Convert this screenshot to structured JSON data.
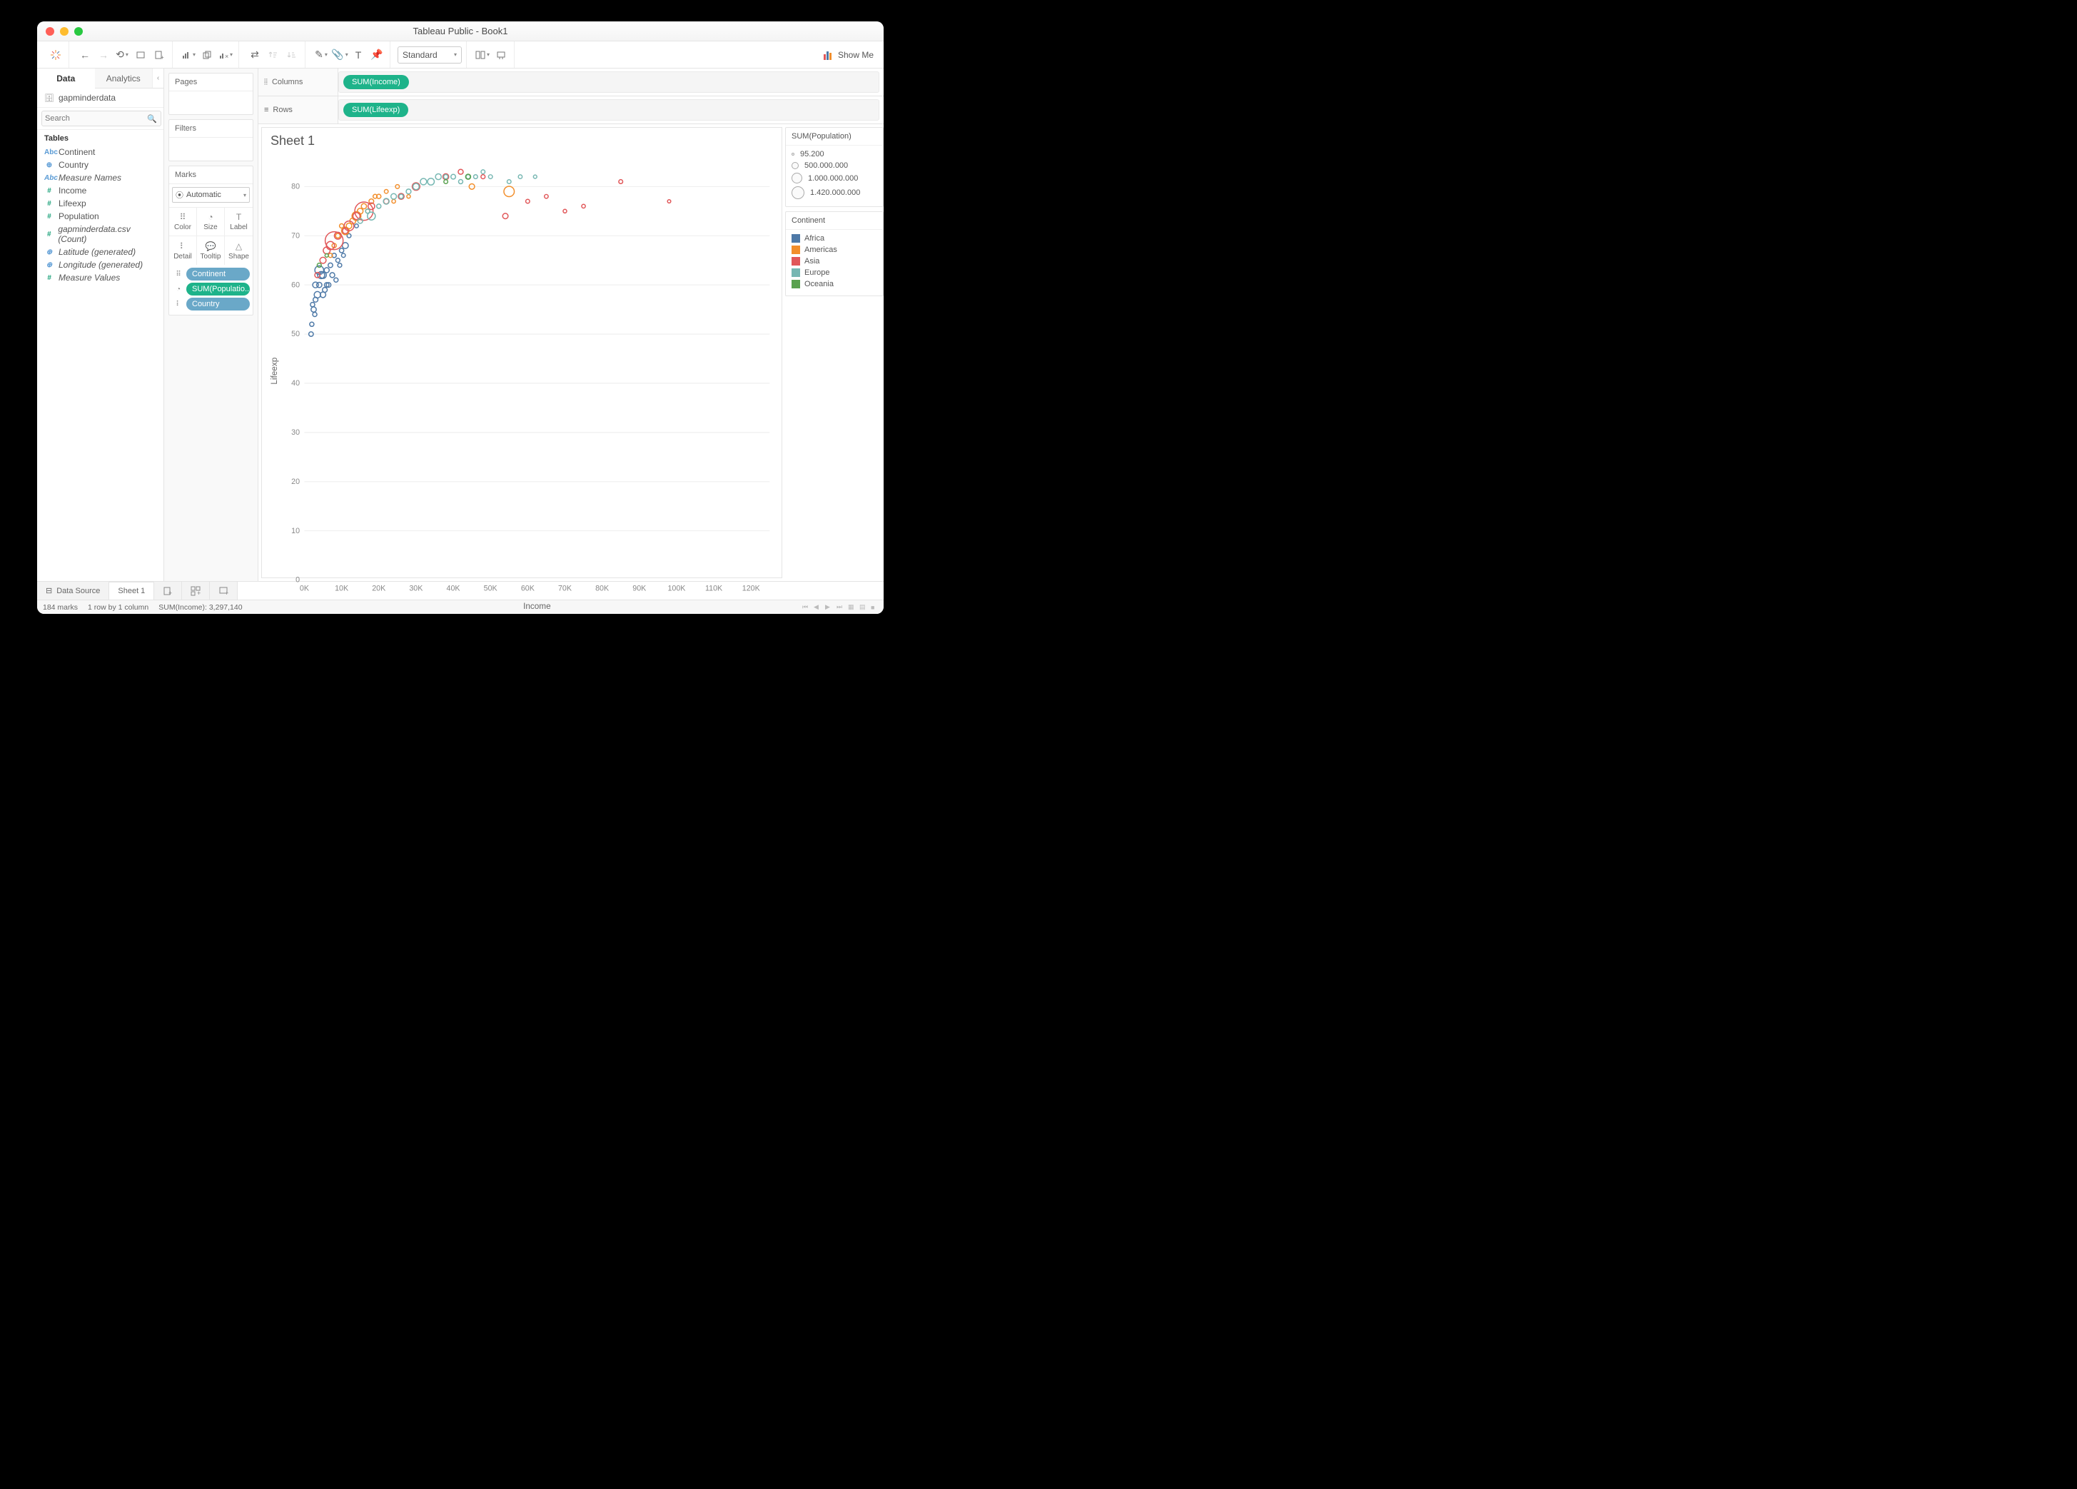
{
  "window": {
    "title": "Tableau Public - Book1"
  },
  "toolbar": {
    "fit_mode": "Standard",
    "show_me": "Show Me"
  },
  "sidebar": {
    "tabs": {
      "data": "Data",
      "analytics": "Analytics"
    },
    "datasource": "gapminderdata",
    "search_placeholder": "Search",
    "tables_title": "Tables",
    "fields": [
      {
        "name": "Continent",
        "type": "dim",
        "icon": "Abc"
      },
      {
        "name": "Country",
        "type": "geo",
        "icon": "⊕"
      },
      {
        "name": "Measure Names",
        "type": "dim",
        "icon": "Abc",
        "italic": true
      },
      {
        "name": "Income",
        "type": "meas",
        "icon": "#"
      },
      {
        "name": "Lifeexp",
        "type": "meas",
        "icon": "#"
      },
      {
        "name": "Population",
        "type": "meas",
        "icon": "#"
      },
      {
        "name": "gapminderdata.csv (Count)",
        "type": "meas",
        "icon": "#",
        "italic": true
      },
      {
        "name": "Latitude (generated)",
        "type": "geo",
        "icon": "⊕",
        "italic": true
      },
      {
        "name": "Longitude (generated)",
        "type": "geo",
        "icon": "⊕",
        "italic": true
      },
      {
        "name": "Measure Values",
        "type": "meas",
        "icon": "#",
        "italic": true
      }
    ]
  },
  "cards": {
    "pages": "Pages",
    "filters": "Filters",
    "marks": "Marks",
    "mark_type": "Automatic",
    "cells": {
      "color": "Color",
      "size": "Size",
      "label": "Label",
      "detail": "Detail",
      "tooltip": "Tooltip",
      "shape": "Shape"
    },
    "pills": [
      {
        "icon": "color",
        "text": "Continent",
        "kind": "dim"
      },
      {
        "icon": "size",
        "text": "SUM(Populatio..",
        "kind": "meas"
      },
      {
        "icon": "detail",
        "text": "Country",
        "kind": "dim"
      }
    ]
  },
  "shelves": {
    "columns_label": "Columns",
    "rows_label": "Rows",
    "columns_pill": "SUM(Income)",
    "rows_pill": "SUM(Lifeexp)"
  },
  "viz": {
    "title": "Sheet 1"
  },
  "legends": {
    "size_title": "SUM(Population)",
    "sizes": [
      {
        "px": 4,
        "label": "95.200"
      },
      {
        "px": 10,
        "label": "500.000.000"
      },
      {
        "px": 15,
        "label": "1.000.000.000"
      },
      {
        "px": 18,
        "label": "1.420.000.000"
      }
    ],
    "color_title": "Continent",
    "colors": [
      {
        "name": "Africa",
        "hex": "#4e79a7"
      },
      {
        "name": "Americas",
        "hex": "#f28e2b"
      },
      {
        "name": "Asia",
        "hex": "#e15759"
      },
      {
        "name": "Europe",
        "hex": "#76b7b2"
      },
      {
        "name": "Oceania",
        "hex": "#59a14f"
      }
    ]
  },
  "footer": {
    "data_source": "Data Source",
    "sheet": "Sheet 1"
  },
  "status": {
    "marks": "184 marks",
    "layout": "1 row by 1 column",
    "agg": "SUM(Income): 3,297,140"
  },
  "chart_data": {
    "type": "scatter",
    "title": "Sheet 1",
    "xlabel": "Income",
    "ylabel": "Lifeexp",
    "xlim": [
      0,
      125000
    ],
    "ylim": [
      0,
      85
    ],
    "xticks": [
      0,
      10000,
      20000,
      30000,
      40000,
      50000,
      60000,
      70000,
      80000,
      90000,
      100000,
      110000,
      120000
    ],
    "xticklabels": [
      "0K",
      "10K",
      "20K",
      "30K",
      "40K",
      "50K",
      "60K",
      "70K",
      "80K",
      "90K",
      "100K",
      "110K",
      "120K"
    ],
    "yticks": [
      0,
      10,
      20,
      30,
      40,
      50,
      60,
      70,
      80
    ],
    "size_field": "SUM(Population)",
    "size_range": [
      95200,
      1420000000
    ],
    "color_field": "Continent",
    "color_map": {
      "Africa": "#4e79a7",
      "Americas": "#f28e2b",
      "Asia": "#e15759",
      "Europe": "#76b7b2",
      "Oceania": "#59a14f"
    },
    "series": [
      {
        "name": "Africa",
        "points": [
          {
            "x": 2000,
            "y": 52,
            "p": 10000000
          },
          {
            "x": 3000,
            "y": 57,
            "p": 20000000
          },
          {
            "x": 4000,
            "y": 60,
            "p": 30000000
          },
          {
            "x": 5000,
            "y": 62,
            "p": 80000000
          },
          {
            "x": 6000,
            "y": 63,
            "p": 25000000
          },
          {
            "x": 7000,
            "y": 64,
            "p": 15000000
          },
          {
            "x": 8000,
            "y": 66,
            "p": 10000000
          },
          {
            "x": 9000,
            "y": 65,
            "p": 8000000
          },
          {
            "x": 10000,
            "y": 67,
            "p": 12000000
          },
          {
            "x": 3000,
            "y": 60,
            "p": 45000000
          },
          {
            "x": 2500,
            "y": 55,
            "p": 30000000
          },
          {
            "x": 1800,
            "y": 50,
            "p": 15000000
          },
          {
            "x": 4500,
            "y": 62,
            "p": 100000000
          },
          {
            "x": 5500,
            "y": 59,
            "p": 20000000
          },
          {
            "x": 6500,
            "y": 60,
            "p": 18000000
          },
          {
            "x": 7500,
            "y": 62,
            "p": 22000000
          },
          {
            "x": 8500,
            "y": 61,
            "p": 9000000
          },
          {
            "x": 11000,
            "y": 68,
            "p": 55000000
          },
          {
            "x": 12000,
            "y": 70,
            "p": 6000000
          },
          {
            "x": 14000,
            "y": 72,
            "p": 4000000
          },
          {
            "x": 2200,
            "y": 56,
            "p": 12000000
          },
          {
            "x": 3500,
            "y": 58,
            "p": 70000000
          },
          {
            "x": 4000,
            "y": 63,
            "p": 200000000
          },
          {
            "x": 5000,
            "y": 58,
            "p": 40000000
          },
          {
            "x": 6000,
            "y": 60,
            "p": 15000000
          },
          {
            "x": 2800,
            "y": 54,
            "p": 10000000
          },
          {
            "x": 9500,
            "y": 64,
            "p": 7000000
          },
          {
            "x": 10500,
            "y": 66,
            "p": 5000000
          }
        ]
      },
      {
        "name": "Americas",
        "points": [
          {
            "x": 12000,
            "y": 72,
            "p": 40000000
          },
          {
            "x": 14000,
            "y": 74,
            "p": 210000000
          },
          {
            "x": 15000,
            "y": 75,
            "p": 45000000
          },
          {
            "x": 16000,
            "y": 76,
            "p": 30000000
          },
          {
            "x": 18000,
            "y": 77,
            "p": 18000000
          },
          {
            "x": 20000,
            "y": 78,
            "p": 10000000
          },
          {
            "x": 11000,
            "y": 71,
            "p": 120000000
          },
          {
            "x": 13000,
            "y": 73,
            "p": 50000000
          },
          {
            "x": 17000,
            "y": 75,
            "p": 8000000
          },
          {
            "x": 19000,
            "y": 78,
            "p": 6000000
          },
          {
            "x": 22000,
            "y": 79,
            "p": 4000000
          },
          {
            "x": 25000,
            "y": 80,
            "p": 5000000
          },
          {
            "x": 9000,
            "y": 70,
            "p": 15000000
          },
          {
            "x": 10000,
            "y": 72,
            "p": 9000000
          },
          {
            "x": 45000,
            "y": 80,
            "p": 37000000
          },
          {
            "x": 55000,
            "y": 79,
            "p": 330000000
          },
          {
            "x": 8000,
            "y": 68,
            "p": 11000000
          },
          {
            "x": 7000,
            "y": 66,
            "p": 7000000
          },
          {
            "x": 24000,
            "y": 77,
            "p": 3000000
          },
          {
            "x": 28000,
            "y": 78,
            "p": 2000000
          }
        ]
      },
      {
        "name": "Asia",
        "points": [
          {
            "x": 6000,
            "y": 67,
            "p": 90000000
          },
          {
            "x": 7000,
            "y": 68,
            "p": 160000000
          },
          {
            "x": 8000,
            "y": 69,
            "p": 1350000000
          },
          {
            "x": 12000,
            "y": 72,
            "p": 270000000
          },
          {
            "x": 14000,
            "y": 74,
            "p": 100000000
          },
          {
            "x": 16000,
            "y": 75,
            "p": 1420000000
          },
          {
            "x": 18000,
            "y": 76,
            "p": 80000000
          },
          {
            "x": 22000,
            "y": 77,
            "p": 30000000
          },
          {
            "x": 26000,
            "y": 78,
            "p": 50000000
          },
          {
            "x": 30000,
            "y": 80,
            "p": 127000000
          },
          {
            "x": 38000,
            "y": 82,
            "p": 51000000
          },
          {
            "x": 42000,
            "y": 83,
            "p": 23000000
          },
          {
            "x": 48000,
            "y": 82,
            "p": 8000000
          },
          {
            "x": 60000,
            "y": 77,
            "p": 5000000
          },
          {
            "x": 65000,
            "y": 78,
            "p": 4000000
          },
          {
            "x": 75000,
            "y": 76,
            "p": 3000000
          },
          {
            "x": 85000,
            "y": 81,
            "p": 6000000
          },
          {
            "x": 98000,
            "y": 77,
            "p": 500000
          },
          {
            "x": 70000,
            "y": 75,
            "p": 2000000
          },
          {
            "x": 54000,
            "y": 74,
            "p": 34000000
          },
          {
            "x": 5000,
            "y": 65,
            "p": 60000000
          },
          {
            "x": 9000,
            "y": 70,
            "p": 95000000
          },
          {
            "x": 11000,
            "y": 71,
            "p": 40000000
          },
          {
            "x": 3500,
            "y": 62,
            "p": 30000000
          }
        ]
      },
      {
        "name": "Europe",
        "points": [
          {
            "x": 20000,
            "y": 76,
            "p": 10000000
          },
          {
            "x": 24000,
            "y": 78,
            "p": 38000000
          },
          {
            "x": 28000,
            "y": 79,
            "p": 20000000
          },
          {
            "x": 30000,
            "y": 80,
            "p": 60000000
          },
          {
            "x": 32000,
            "y": 81,
            "p": 67000000
          },
          {
            "x": 34000,
            "y": 81,
            "p": 83000000
          },
          {
            "x": 36000,
            "y": 82,
            "p": 47000000
          },
          {
            "x": 38000,
            "y": 82,
            "p": 10000000
          },
          {
            "x": 40000,
            "y": 82,
            "p": 17000000
          },
          {
            "x": 42000,
            "y": 81,
            "p": 9000000
          },
          {
            "x": 44000,
            "y": 82,
            "p": 8000000
          },
          {
            "x": 46000,
            "y": 82,
            "p": 6000000
          },
          {
            "x": 48000,
            "y": 83,
            "p": 5000000
          },
          {
            "x": 50000,
            "y": 82,
            "p": 5000000
          },
          {
            "x": 55000,
            "y": 81,
            "p": 5000000
          },
          {
            "x": 58000,
            "y": 82,
            "p": 4000000
          },
          {
            "x": 62000,
            "y": 82,
            "p": 1000000
          },
          {
            "x": 18000,
            "y": 74,
            "p": 145000000
          },
          {
            "x": 22000,
            "y": 77,
            "p": 45000000
          },
          {
            "x": 26000,
            "y": 78,
            "p": 11000000
          },
          {
            "x": 15000,
            "y": 73,
            "p": 20000000
          },
          {
            "x": 17000,
            "y": 75,
            "p": 9000000
          }
        ]
      },
      {
        "name": "Oceania",
        "points": [
          {
            "x": 44000,
            "y": 82,
            "p": 25000000
          },
          {
            "x": 38000,
            "y": 81,
            "p": 5000000
          },
          {
            "x": 4000,
            "y": 64,
            "p": 8000000
          },
          {
            "x": 6000,
            "y": 66,
            "p": 900000
          }
        ]
      }
    ]
  }
}
